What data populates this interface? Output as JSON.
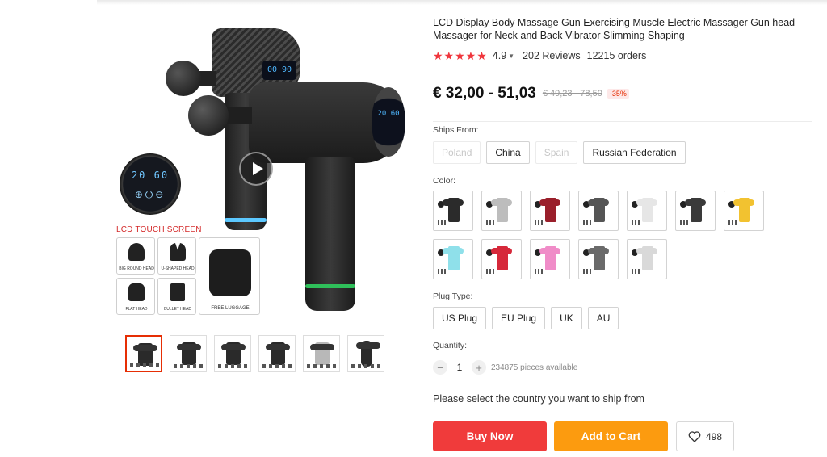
{
  "gallery": {
    "lcd_caption": "LCD TOUCH SCREEN",
    "lcd_numbers": "20 60",
    "lcd_controls": "⊕⏻⊖",
    "screen_back_text": "00 90",
    "screen_front_text": "20 60",
    "heads": [
      {
        "label": "BIG ROUND HEAD"
      },
      {
        "label": "U-SHAPED HEAD"
      },
      {
        "label": "FLAT HEAD"
      },
      {
        "label": "BULLET HEAD"
      }
    ],
    "luggage_label": "FREE LUGGAGE",
    "thumbnail_count": 6
  },
  "product": {
    "title": "LCD Display Body Massage Gun Exercising Muscle Electric Massager Gun head Massager for Neck and Back Vibrator Slimming Shaping",
    "stars": "★★★★★",
    "rating": "4.9",
    "reviews": "202 Reviews",
    "orders": "12215 orders",
    "price": "€ 32,00 - 51,03",
    "old_price": "€ 49,23 - 78,50",
    "discount": "-35%"
  },
  "ships_from": {
    "label": "Ships From:",
    "options": [
      {
        "label": "Poland",
        "disabled": true
      },
      {
        "label": "China",
        "disabled": false
      },
      {
        "label": "Spain",
        "disabled": true
      },
      {
        "label": "Russian Federation",
        "disabled": false
      }
    ]
  },
  "color": {
    "label": "Color:",
    "swatches": [
      "#2b2b2b",
      "#bdbdbd",
      "#9a1f2b",
      "#555555",
      "#e6e6e6",
      "#3a3a3a",
      "#f2c230",
      "#8fe0ea",
      "#d6283a",
      "#f08cc8",
      "#6a6a6a",
      "#d9d9d9"
    ]
  },
  "plug": {
    "label": "Plug Type:",
    "options": [
      "US Plug",
      "EU Plug",
      "UK",
      "AU"
    ]
  },
  "quantity": {
    "label": "Quantity:",
    "minus": "−",
    "plus": "+",
    "value": "1",
    "available": "234875 pieces available"
  },
  "ship_note": "Please select the country you want to ship from",
  "actions": {
    "buy_now": "Buy Now",
    "add_to_cart": "Add to Cart",
    "wishlist_count": "498"
  },
  "colors": {
    "accent_red": "#f03b3b",
    "accent_orange": "#fc9b0f",
    "star_red": "#f0353c"
  }
}
